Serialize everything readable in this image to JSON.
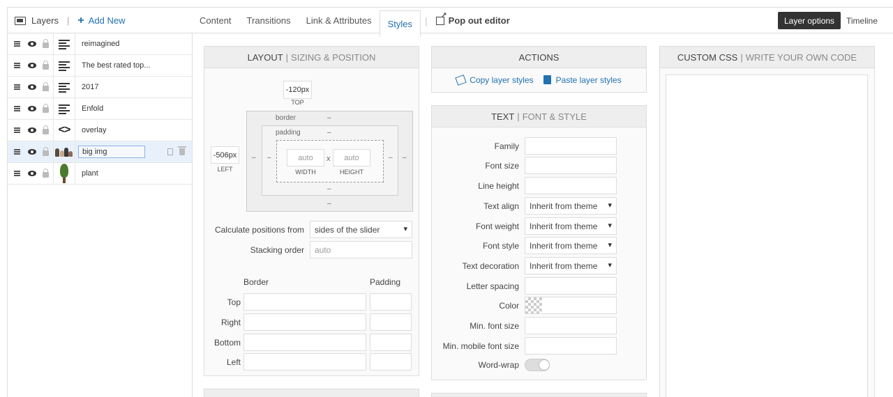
{
  "layers_header": {
    "title": "Layers",
    "separator": "|",
    "add_new": "Add New"
  },
  "tabs": [
    {
      "label": "Content"
    },
    {
      "label": "Transitions"
    },
    {
      "label": "Link & Attributes"
    },
    {
      "label": "Styles"
    }
  ],
  "tab_separator": "|",
  "popout": {
    "label": "Pop out editor"
  },
  "right_controls": {
    "layer_options": "Layer options",
    "timeline": "Timeline"
  },
  "layers": [
    {
      "name": "reimagined",
      "type": "text-icon"
    },
    {
      "name": "The best rated top...",
      "type": "text-icon"
    },
    {
      "name": "2017",
      "type": "text-icon"
    },
    {
      "name": "Enfold",
      "type": "text-icon"
    },
    {
      "name": "overlay",
      "type": "code-icon"
    },
    {
      "name": "big img",
      "type": "image-thumb",
      "selected": true
    },
    {
      "name": "plant",
      "type": "plant-thumb"
    }
  ],
  "layout_panel": {
    "title": "LAYOUT",
    "bar": "|",
    "subtitle": "SIZING & POSITION",
    "top_value": "-120px",
    "top_label": "TOP",
    "left_value": "-506px",
    "left_label": "LEFT",
    "border_label": "border",
    "padding_label": "padding",
    "dash": "–",
    "width_value": "auto",
    "width_label": "WIDTH",
    "height_value": "auto",
    "height_label": "HEIGHT",
    "times": "x",
    "calc_label": "Calculate positions from",
    "calc_value": "sides of the slider",
    "stack_label": "Stacking order",
    "stack_placeholder": "auto",
    "border_header": "Border",
    "padding_header": "Padding",
    "sides": [
      {
        "label": "Top"
      },
      {
        "label": "Right"
      },
      {
        "label": "Bottom"
      },
      {
        "label": "Left"
      }
    ]
  },
  "actions_panel": {
    "title": "ACTIONS",
    "copy": "Copy layer styles",
    "paste": "Paste layer styles"
  },
  "text_panel": {
    "title": "TEXT",
    "bar": "|",
    "subtitle": "FONT & STYLE",
    "fields": [
      {
        "label": "Family",
        "kind": "input",
        "value": ""
      },
      {
        "label": "Font size",
        "kind": "input",
        "value": ""
      },
      {
        "label": "Line height",
        "kind": "input",
        "value": ""
      },
      {
        "label": "Text align",
        "kind": "select",
        "value": "Inherit from theme"
      },
      {
        "label": "Font weight",
        "kind": "select",
        "value": "Inherit from theme"
      },
      {
        "label": "Font style",
        "kind": "select",
        "value": "Inherit from theme"
      },
      {
        "label": "Text decoration",
        "kind": "select",
        "value": "Inherit from theme"
      },
      {
        "label": "Letter spacing",
        "kind": "input",
        "value": ""
      },
      {
        "label": "Color",
        "kind": "color",
        "value": ""
      },
      {
        "label": "Min. font size",
        "kind": "input",
        "value": ""
      },
      {
        "label": "Min. mobile font size",
        "kind": "input",
        "value": ""
      }
    ],
    "wordwrap_label": "Word-wrap"
  },
  "css_panel": {
    "title": "CUSTOM CSS",
    "bar": "|",
    "subtitle": "WRITE YOUR OWN CODE"
  },
  "colors": {
    "accent": "#2271b1",
    "dark_button": "#333333",
    "selected_row": "#e8f1fb"
  }
}
